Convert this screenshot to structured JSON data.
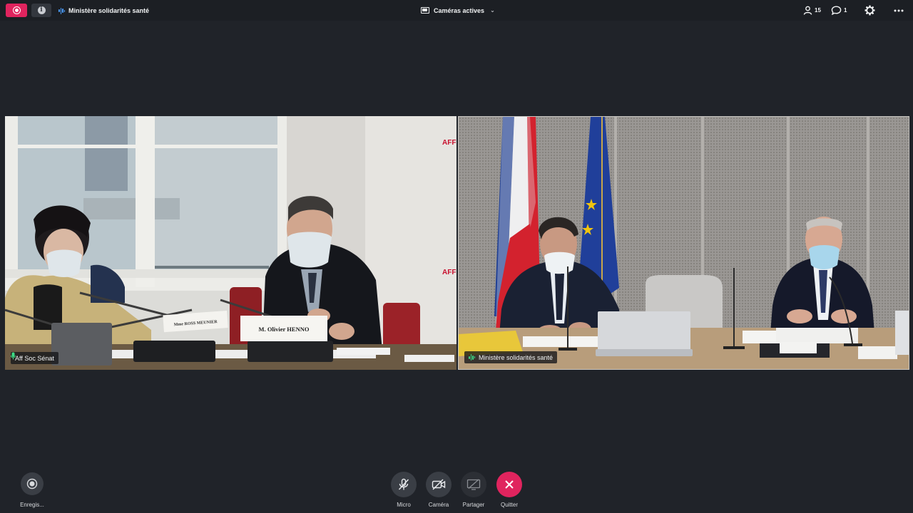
{
  "topbar": {
    "room_title": "Ministère solidarités santé",
    "layout_label": "Caméras actives",
    "participants_count": "15",
    "chat_count": "1"
  },
  "tiles": [
    {
      "label": "Aff Soc Sénat",
      "name_plates": [
        "Mme ROSS MEUNIER",
        "M. Olivier HENNO"
      ],
      "wall_text": "AFF"
    },
    {
      "label": "Ministère solidarités santé"
    }
  ],
  "controls": {
    "record_label": "Enregis...",
    "mic_label": "Micro",
    "camera_label": "Caméra",
    "share_label": "Partager",
    "quit_label": "Quitter"
  },
  "colors": {
    "accent_red": "#e0245e",
    "speaking_blue": "#4a9eff",
    "mic_green": "#3ddc84"
  }
}
